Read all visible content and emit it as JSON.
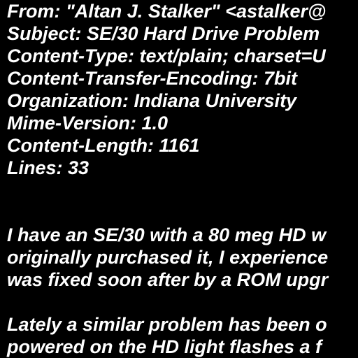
{
  "headers": [
    "From: \"Altan J. Stalker\" <astalker@",
    "Subject: SE/30 Hard Drive Problem",
    "Content-Type: text/plain; charset=U",
    "Content-Transfer-Encoding: 7bit",
    "Organization: Indiana University",
    "Mime-Version: 1.0",
    "Content-Length: 1161",
    "Lines: 33"
  ],
  "body": [
    "I have an SE/30 with a 80 meg HD w",
    "originally purchased it, I experience",
    "was fixed soon after by a ROM upgr",
    "",
    "Lately a similar problem has been o",
    "powered on the HD light flashes a f"
  ],
  "colors": {
    "background": "#000000",
    "text": "#ffffff"
  }
}
